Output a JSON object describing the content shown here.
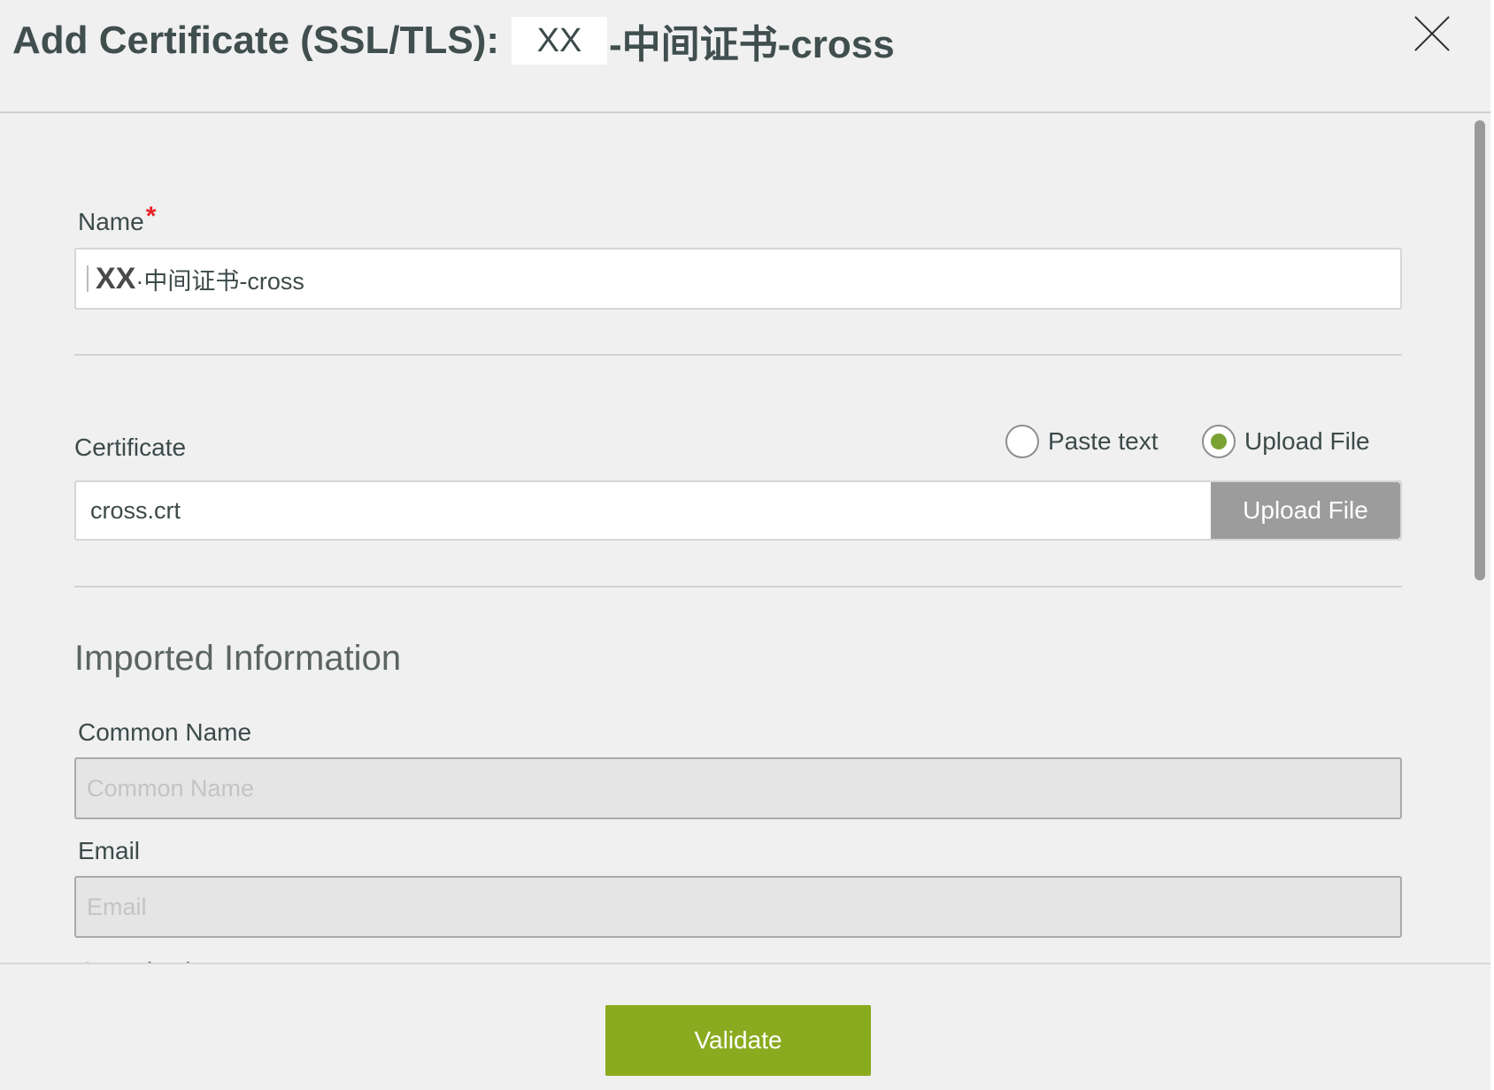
{
  "dialog": {
    "title_prefix": "Add Certificate (SSL/TLS):",
    "title_masked": "XX",
    "title_suffix": "-中间证书-cross"
  },
  "name_field": {
    "label": "Name",
    "required_mark": "*",
    "value_masked": "XX",
    "value_suffix": "·中间证书-cross"
  },
  "certificate": {
    "label": "Certificate",
    "options": [
      {
        "label": "Paste text",
        "selected": false
      },
      {
        "label": "Upload File",
        "selected": true
      }
    ],
    "file_value": "cross.crt",
    "upload_button": "Upload File"
  },
  "imported_info": {
    "section_title": "Imported Information",
    "common_name": {
      "label": "Common Name",
      "placeholder": "Common Name"
    },
    "email": {
      "label": "Email",
      "placeholder": "Email"
    },
    "next_label_partial": "Organization"
  },
  "footer": {
    "validate_button": "Validate"
  },
  "colors": {
    "accent": "#8aab1f",
    "radio_selected": "#79a232",
    "required": "#e8232a"
  }
}
